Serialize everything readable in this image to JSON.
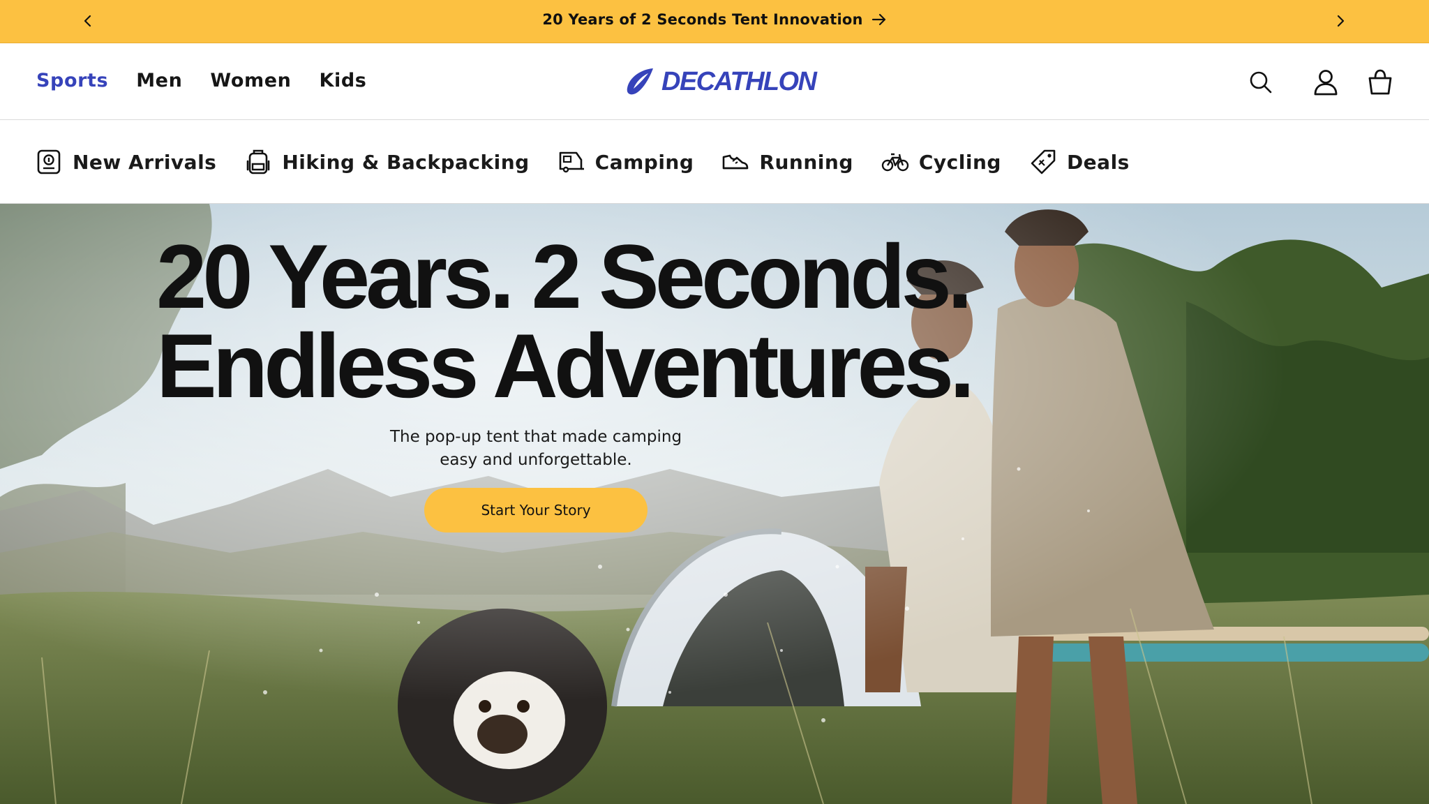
{
  "announcement": {
    "text": "20 Years of 2 Seconds Tent Innovation",
    "prev_icon": "chevron-left-icon",
    "next_icon": "chevron-right-icon",
    "link_icon": "arrow-right-icon",
    "background": "#fcc141"
  },
  "header": {
    "nav": [
      {
        "label": "Sports",
        "active": true
      },
      {
        "label": "Men",
        "active": false
      },
      {
        "label": "Women",
        "active": false
      },
      {
        "label": "Kids",
        "active": false
      }
    ],
    "logo_text": "DECATHLON",
    "brand_color": "#3643ba",
    "icons": [
      "search-icon",
      "account-icon",
      "shopping-bag-icon"
    ]
  },
  "categories": [
    {
      "label": "New Arrivals",
      "icon": "new-tag-icon"
    },
    {
      "label": "Hiking & Backpacking",
      "icon": "backpack-icon"
    },
    {
      "label": "Camping",
      "icon": "camper-icon"
    },
    {
      "label": "Running",
      "icon": "shoe-icon"
    },
    {
      "label": "Cycling",
      "icon": "bicycle-icon"
    },
    {
      "label": "Deals",
      "icon": "price-tag-icon"
    }
  ],
  "hero": {
    "title_line1": "20 Years. 2 Seconds.",
    "title_line2": "Endless Adventures.",
    "subtitle_line1": "The pop-up tent that made camping",
    "subtitle_line2": "easy and unforgettable.",
    "cta_label": "Start Your Story",
    "cta_color": "#fcc141"
  }
}
